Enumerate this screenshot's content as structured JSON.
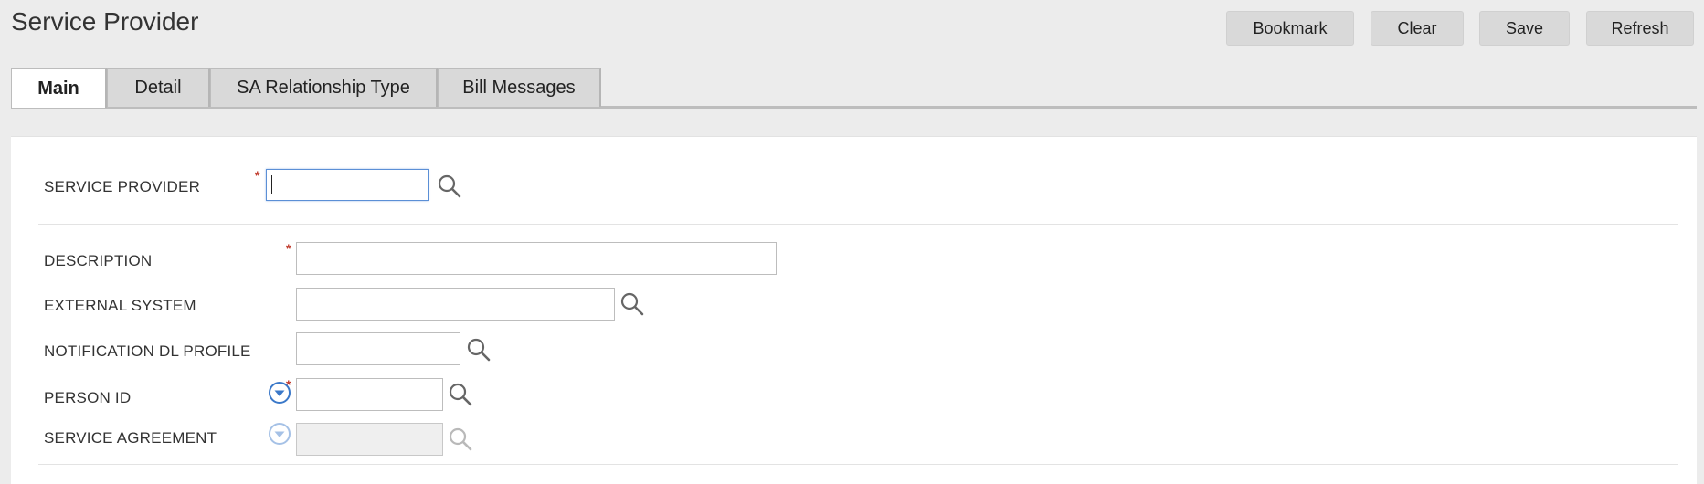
{
  "page": {
    "title": "Service Provider"
  },
  "toolbar": {
    "bookmark_label": "Bookmark",
    "clear_label": "Clear",
    "save_label": "Save",
    "refresh_label": "Refresh"
  },
  "tabs": [
    {
      "label": "Main",
      "active": true
    },
    {
      "label": "Detail",
      "active": false
    },
    {
      "label": "SA Relationship Type",
      "active": false
    },
    {
      "label": "Bill Messages",
      "active": false
    }
  ],
  "form": {
    "required_marker": "*",
    "service_provider": {
      "label": "SERVICE PROVIDER",
      "value": "",
      "required": true
    },
    "description": {
      "label": "DESCRIPTION",
      "value": "",
      "required": true
    },
    "external_system": {
      "label": "EXTERNAL SYSTEM",
      "value": ""
    },
    "notification_dl_profile": {
      "label": "NOTIFICATION DL PROFILE",
      "value": ""
    },
    "person_id": {
      "label": "PERSON ID",
      "value": "",
      "required": true
    },
    "service_agreement": {
      "label": "SERVICE AGREEMENT",
      "value": "",
      "disabled": true
    }
  },
  "icons": {
    "search": "search-icon",
    "dropdown": "chevron-down-circle-icon"
  },
  "colors": {
    "background": "#ececec",
    "panel": "#ffffff",
    "button": "#d9d9d9",
    "required": "#c0392b",
    "focus": "#5b8fd6",
    "dropdown_icon": "#3a78c9"
  }
}
